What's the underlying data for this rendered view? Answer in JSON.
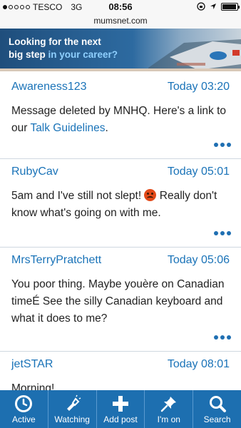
{
  "status": {
    "carrier": "TESCO",
    "network": "3G",
    "time": "08:56"
  },
  "url": "mumsnet.com",
  "banner": {
    "line1": "Looking for the next",
    "line2a": "big step ",
    "line2b": "in your career?"
  },
  "posts": [
    {
      "author": "Awareness123",
      "time": "Today 03:20",
      "text1": "Message deleted by MNHQ. Here's a link to our ",
      "link": "Talk Guidelines",
      "text2": "."
    },
    {
      "author": "RubyCav",
      "time": "Today 05:01",
      "text1": "5am and I've still not slept! ",
      "text2": " Really don't know what's going on with me."
    },
    {
      "author": "MrsTerryPratchett",
      "time": "Today 05:06",
      "text1": "You poor thing. Maybe youère on Canadian timeÉ See the silly Canadian keyboard and what it does to me?"
    },
    {
      "author": "jetSTAR",
      "time": "Today 08:01",
      "text1": "Morning!"
    }
  ],
  "toolbar": [
    {
      "label": "Active",
      "icon": "clock-icon"
    },
    {
      "label": "Watching",
      "icon": "flashlight-icon"
    },
    {
      "label": "Add post",
      "icon": "plus-icon"
    },
    {
      "label": "I'm on",
      "icon": "pin-icon"
    },
    {
      "label": "Search",
      "icon": "search-icon"
    }
  ],
  "colors": {
    "accent": "#1a73b8",
    "toolbar": "#1d6fb0"
  }
}
